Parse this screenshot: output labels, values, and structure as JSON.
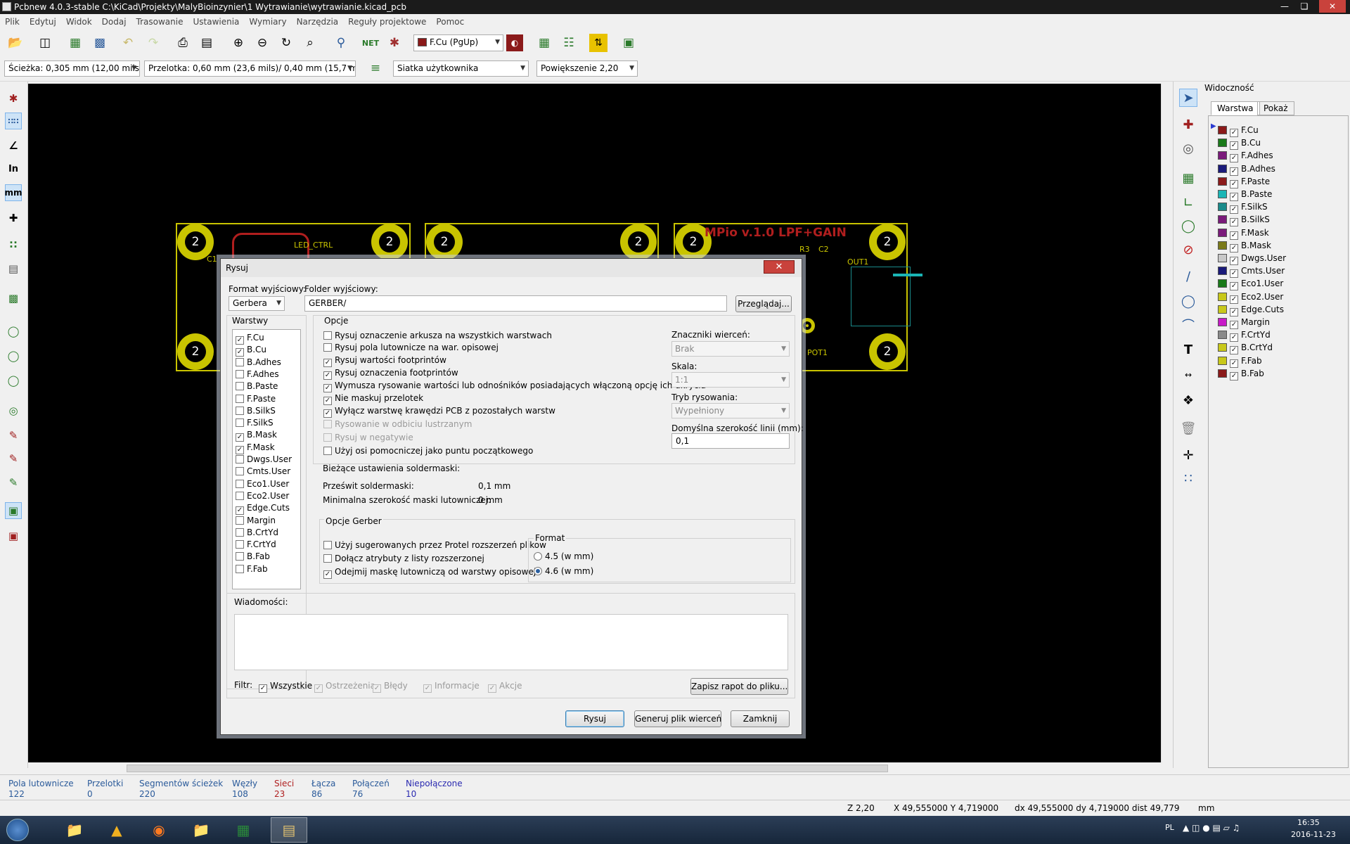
{
  "window": {
    "title": "Pcbnew 4.0.3-stable C:\\KiCad\\Projekty\\MalyBioinzynier\\1 Wytrawianie\\wytrawianie.kicad_pcb"
  },
  "menu": [
    "Plik",
    "Edytuj",
    "Widok",
    "Dodaj",
    "Trasowanie",
    "Ustawienia",
    "Wymiary",
    "Narzędzia",
    "Reguły projektowe",
    "Pomoc"
  ],
  "toolbar": {
    "layer_select": "F.Cu (PgUp)"
  },
  "toolbar2": {
    "track": "Ścieżka: 0,305 mm (12,00 mils) *",
    "via": "Przelotka: 0,60 mm (23,6 mils)/ 0,40 mm (15,7 mils) *",
    "grid": "Siatka użytkownika",
    "zoom": "Powiększenie 2,20"
  },
  "lefttools": {
    "in": "In",
    "mm": "mm"
  },
  "canvas": {
    "pad_number": "2",
    "silk1": "MPio v.1.0 LPF+GAIN",
    "silk_led": "LED_CTRL",
    "silk_r3": "R3",
    "silk_out1": "OUT1",
    "silk_pot1": "POT1",
    "silk_c1": "C1",
    "silk_c2": "C2"
  },
  "visibility": {
    "title": "Widoczność",
    "tab_layers": "Warstwa",
    "tab_render": "Pokaż",
    "layers": [
      {
        "name": "F.Cu",
        "color": "#8b1a1a",
        "checked": true
      },
      {
        "name": "B.Cu",
        "color": "#1a7a1a",
        "checked": true
      },
      {
        "name": "F.Adhes",
        "color": "#7a1a7a",
        "checked": true
      },
      {
        "name": "B.Adhes",
        "color": "#1a1a7a",
        "checked": true
      },
      {
        "name": "F.Paste",
        "color": "#8b1a1a",
        "checked": true
      },
      {
        "name": "B.Paste",
        "color": "#1ab5b5",
        "checked": true
      },
      {
        "name": "F.SilkS",
        "color": "#1a8b8b",
        "checked": true
      },
      {
        "name": "B.SilkS",
        "color": "#7a1a7a",
        "checked": true
      },
      {
        "name": "F.Mask",
        "color": "#7a1a7a",
        "checked": true
      },
      {
        "name": "B.Mask",
        "color": "#7a7a1a",
        "checked": true
      },
      {
        "name": "Dwgs.User",
        "color": "#c8c8c8",
        "checked": true
      },
      {
        "name": "Cmts.User",
        "color": "#1a1a7a",
        "checked": true
      },
      {
        "name": "Eco1.User",
        "color": "#1a7a1a",
        "checked": true
      },
      {
        "name": "Eco2.User",
        "color": "#c8c81a",
        "checked": true
      },
      {
        "name": "Edge.Cuts",
        "color": "#c8c81a",
        "checked": true
      },
      {
        "name": "Margin",
        "color": "#c81ac8",
        "checked": true
      },
      {
        "name": "F.CrtYd",
        "color": "#8a8a8a",
        "checked": true
      },
      {
        "name": "B.CrtYd",
        "color": "#c8c81a",
        "checked": true
      },
      {
        "name": "F.Fab",
        "color": "#c8c81a",
        "checked": true
      },
      {
        "name": "B.Fab",
        "color": "#8b1a1a",
        "checked": true
      }
    ]
  },
  "dialog": {
    "title": "Rysuj",
    "format_label": "Format wyjściowy:",
    "format_value": "Gerbera",
    "folder_label": "Folder wyjściowy:",
    "folder_value": "GERBER/",
    "browse": "Przeglądaj...",
    "layers_title": "Warstwy",
    "layers": [
      {
        "name": "F.Cu",
        "checked": true
      },
      {
        "name": "B.Cu",
        "checked": true
      },
      {
        "name": "B.Adhes",
        "checked": false
      },
      {
        "name": "F.Adhes",
        "checked": false
      },
      {
        "name": "B.Paste",
        "checked": false
      },
      {
        "name": "F.Paste",
        "checked": false
      },
      {
        "name": "B.SilkS",
        "checked": false
      },
      {
        "name": "F.SilkS",
        "checked": false
      },
      {
        "name": "B.Mask",
        "checked": true
      },
      {
        "name": "F.Mask",
        "checked": true
      },
      {
        "name": "Dwgs.User",
        "checked": false
      },
      {
        "name": "Cmts.User",
        "checked": false
      },
      {
        "name": "Eco1.User",
        "checked": false
      },
      {
        "name": "Eco2.User",
        "checked": false
      },
      {
        "name": "Edge.Cuts",
        "checked": true
      },
      {
        "name": "Margin",
        "checked": false
      },
      {
        "name": "B.CrtYd",
        "checked": false
      },
      {
        "name": "F.CrtYd",
        "checked": false
      },
      {
        "name": "B.Fab",
        "checked": false
      },
      {
        "name": "F.Fab",
        "checked": false
      }
    ],
    "options_title": "Opcje",
    "options": [
      {
        "text": "Rysuj oznaczenie arkusza na wszystkich warstwach",
        "checked": false,
        "disabled": false
      },
      {
        "text": "Rysuj pola lutownicze na war. opisowej",
        "checked": false,
        "disabled": false
      },
      {
        "text": "Rysuj wartości footprintów",
        "checked": true,
        "disabled": false
      },
      {
        "text": "Rysuj oznaczenia footprintów",
        "checked": true,
        "disabled": false
      },
      {
        "text": "Wymusza rysowanie wartości lub odnośników posiadających włączoną opcję ich ukrycia",
        "checked": true,
        "disabled": false
      },
      {
        "text": "Nie maskuj przelotek",
        "checked": true,
        "disabled": false
      },
      {
        "text": "Wyłącz warstwę krawędzi PCB z pozostałych warstw",
        "checked": true,
        "disabled": false
      },
      {
        "text": "Rysowanie w odbiciu lustrzanym",
        "checked": false,
        "disabled": true
      },
      {
        "text": "Rysuj w negatywie",
        "checked": false,
        "disabled": true
      },
      {
        "text": "Użyj osi pomocniczej jako puntu początkowego",
        "checked": false,
        "disabled": false
      }
    ],
    "drill_label": "Znaczniki wierceń:",
    "drill_value": "Brak",
    "scale_label": "Skala:",
    "scale_value": "1:1",
    "mode_label": "Tryb rysowania:",
    "mode_value": "Wypełniony",
    "linewidth_label": "Domyślna szerokość linii (mm):",
    "linewidth_value": "0,1",
    "soldermask_title": "Bieżące ustawienia soldermaski:",
    "clearance_label": "Prześwit soldermaski:",
    "clearance_value": "0,1 mm",
    "minwidth_label": "Minimalna szerokość maski lutowniczej:",
    "minwidth_value": "0 mm",
    "gerber_title": "Opcje Gerber",
    "gerber_options": [
      {
        "text": "Użyj sugerowanych przez Protel rozszerzeń plików",
        "checked": false
      },
      {
        "text": "Dołącz atrybuty z listy rozszerzonej",
        "checked": false
      },
      {
        "text": "Odejmij maskę lutowniczą od warstwy opisowej",
        "checked": true
      }
    ],
    "format_group": "Format",
    "format_opts": [
      "4.5 (w mm)",
      "4.6 (w mm)"
    ],
    "messages_title": "Wiadomości:",
    "filter_label": "Filtr:",
    "filters": [
      {
        "text": "Wszystkie",
        "checked": true,
        "disabled": false
      },
      {
        "text": "Ostrzeżenia",
        "checked": true,
        "disabled": true
      },
      {
        "text": "Błędy",
        "checked": true,
        "disabled": true
      },
      {
        "text": "Informacje",
        "checked": true,
        "disabled": true
      },
      {
        "text": "Akcje",
        "checked": true,
        "disabled": true
      }
    ],
    "save_report": "Zapisz rapot do pliku...",
    "plot": "Rysuj",
    "drill": "Generuj plik wierceń",
    "close": "Zamknij"
  },
  "status": [
    {
      "label": "Pola lutownicze",
      "value": "122",
      "color": "#2a5a9a"
    },
    {
      "label": "Przelotki",
      "value": "0",
      "color": "#2a5a9a"
    },
    {
      "label": "Segmentów ścieżek",
      "value": "220",
      "color": "#2a5a9a"
    },
    {
      "label": "Węzły",
      "value": "108",
      "color": "#2a5a9a"
    },
    {
      "label": "Sieci",
      "value": "23",
      "color": "#b02020"
    },
    {
      "label": "Łącza",
      "value": "86",
      "color": "#2a5a9a"
    },
    {
      "label": "Połączeń",
      "value": "76",
      "color": "#2a5a9a"
    },
    {
      "label": "Niepołączone",
      "value": "10",
      "color": "#2a2ab0"
    }
  ],
  "coords": {
    "z": "Z 2,20",
    "xy": "X 49,555000  Y 4,719000",
    "dxy": "dx 49,555000  dy 4,719000  dist 49,779",
    "unit": "mm"
  },
  "taskbar": {
    "lang": "PL",
    "time": "16:35",
    "date": "2016-11-23"
  }
}
